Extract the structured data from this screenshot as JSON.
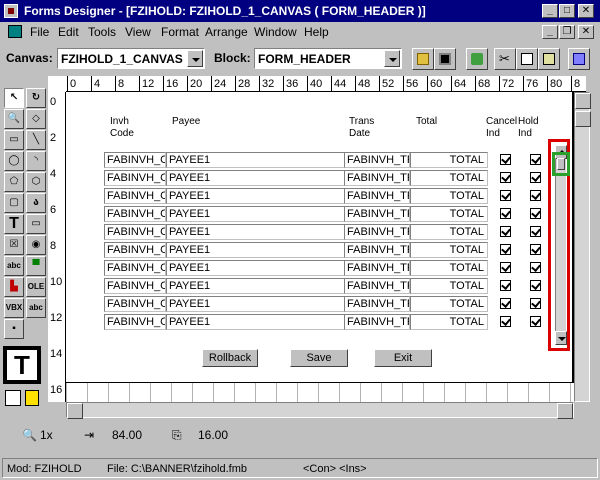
{
  "window": {
    "title": "Forms Designer - [FZIHOLD: FZIHOLD_1_CANVAS ( FORM_HEADER )]"
  },
  "menu": [
    "File",
    "Edit",
    "Tools",
    "View",
    "Format",
    "Arrange",
    "Window",
    "Help"
  ],
  "toolbar": {
    "canvas_label": "Canvas:",
    "canvas_value": "FZIHOLD_1_CANVAS",
    "block_label": "Block:",
    "block_value": "FORM_HEADER"
  },
  "ruler": {
    "h": [
      "0",
      "4",
      "8",
      "12",
      "16",
      "20",
      "24",
      "28",
      "32",
      "36",
      "40",
      "44",
      "48",
      "52",
      "56",
      "60",
      "64",
      "68",
      "72",
      "76",
      "80",
      "8"
    ],
    "v": [
      "0",
      "2",
      "4",
      "6",
      "8",
      "10",
      "12",
      "14",
      "16"
    ]
  },
  "form": {
    "headers": {
      "invh": "Invh\nCode",
      "payee": "Payee",
      "trans": "Trans\nDate",
      "total": "Total",
      "cancel": "Cancel\nInd",
      "hold": "Hold\nInd"
    },
    "rows": [
      {
        "code": "FABINVH_C",
        "payee": "PAYEE1",
        "date": "FABINVH_TR",
        "total": "TOTAL"
      },
      {
        "code": "FABINVH_C",
        "payee": "PAYEE1",
        "date": "FABINVH_TR",
        "total": "TOTAL"
      },
      {
        "code": "FABINVH_C",
        "payee": "PAYEE1",
        "date": "FABINVH_TR",
        "total": "TOTAL"
      },
      {
        "code": "FABINVH_C",
        "payee": "PAYEE1",
        "date": "FABINVH_TR",
        "total": "TOTAL"
      },
      {
        "code": "FABINVH_C",
        "payee": "PAYEE1",
        "date": "FABINVH_TR",
        "total": "TOTAL"
      },
      {
        "code": "FABINVH_C",
        "payee": "PAYEE1",
        "date": "FABINVH_TR",
        "total": "TOTAL"
      },
      {
        "code": "FABINVH_C",
        "payee": "PAYEE1",
        "date": "FABINVH_TR",
        "total": "TOTAL"
      },
      {
        "code": "FABINVH_C",
        "payee": "PAYEE1",
        "date": "FABINVH_TR",
        "total": "TOTAL"
      },
      {
        "code": "FABINVH_C",
        "payee": "PAYEE1",
        "date": "FABINVH_TR",
        "total": "TOTAL"
      },
      {
        "code": "FABINVH_C",
        "payee": "PAYEE1",
        "date": "FABINVH_TR",
        "total": "TOTAL"
      }
    ],
    "buttons": {
      "rollback": "Rollback",
      "save": "Save",
      "exit": "Exit"
    }
  },
  "palette": {
    "text_tool": "T",
    "abc": "abc",
    "ole": "OLE",
    "vbx": "VBX"
  },
  "status": {
    "zoom": "1x",
    "x": "84.00",
    "y": "16.00"
  },
  "bottom": {
    "mod": "Mod: FZIHOLD",
    "file": "File: C:\\BANNER\\fzihold.fmb",
    "mode": "<Con> <Ins>"
  },
  "colors": {
    "titlebar": "#000080",
    "highlight_red": "#dd0000",
    "highlight_green": "#2ca02c"
  }
}
